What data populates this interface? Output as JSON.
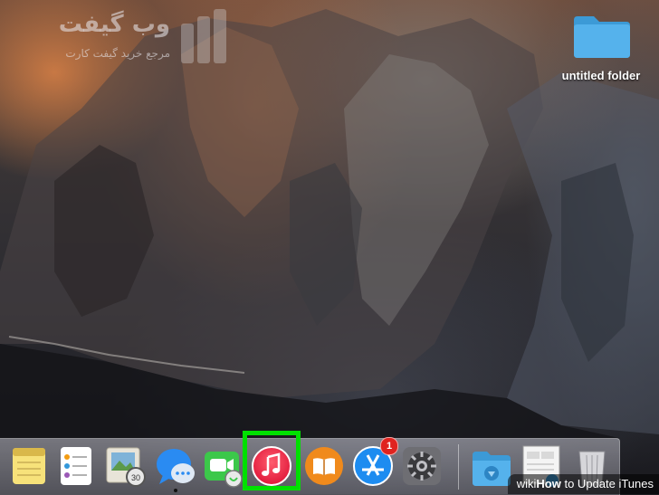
{
  "watermark": {
    "title": "وب گیفت",
    "subtitle": "مرجع خرید گیفت کارت"
  },
  "desktop": {
    "folder_label": "untitled folder",
    "folder_icon": "folder-icon"
  },
  "dock": {
    "items": [
      {
        "name": "notes",
        "icon": "notes-icon"
      },
      {
        "name": "reminders",
        "icon": "reminders-icon"
      },
      {
        "name": "preview",
        "icon": "preview-icon"
      },
      {
        "name": "messages",
        "icon": "messages-icon"
      },
      {
        "name": "facetime",
        "icon": "facetime-icon"
      },
      {
        "name": "itunes",
        "icon": "itunes-icon",
        "highlighted": true
      },
      {
        "name": "ibooks",
        "icon": "ibooks-icon"
      },
      {
        "name": "app-store",
        "icon": "app-store-icon",
        "badge": "1"
      },
      {
        "name": "system-preferences",
        "icon": "gear-icon"
      },
      {
        "name": "downloads",
        "icon": "downloads-folder-icon"
      },
      {
        "name": "documents-stack",
        "icon": "documents-stack-icon"
      },
      {
        "name": "trash",
        "icon": "trash-icon"
      }
    ],
    "app_store_badge": "1"
  },
  "caption": {
    "wiki": "wiki",
    "how": "How",
    "text": " to Update iTunes"
  },
  "colors": {
    "highlight": "#00e000",
    "itunes_red": "#f2304a",
    "folder_blue": "#3fa3e0",
    "badge_red": "#e0231f"
  }
}
